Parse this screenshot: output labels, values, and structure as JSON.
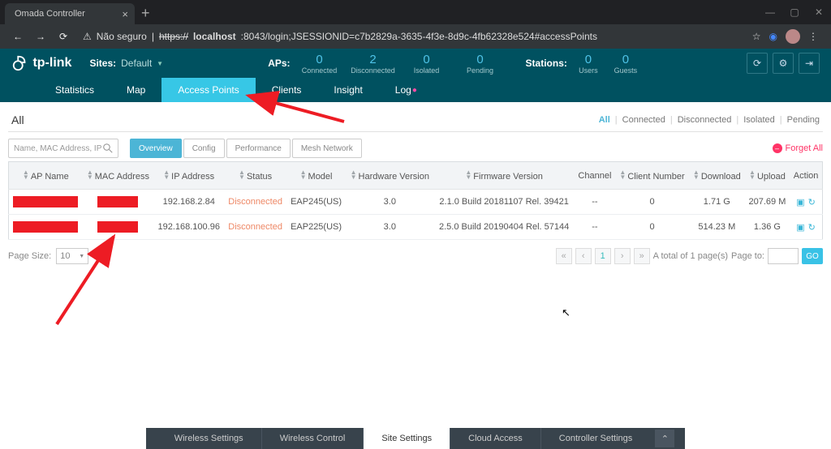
{
  "browser": {
    "tab_title": "Omada Controller",
    "insecure_label": "Não seguro",
    "url_proto": "https://",
    "url_host": "localhost",
    "url_rest": ":8043/login;JSESSIONID=c7b2829a-3635-4f3e-8d9c-4fb62328e524#accessPoints"
  },
  "header": {
    "brand": "tp-link",
    "sites_label": "Sites:",
    "sites_value": "Default",
    "aps_label": "APs:",
    "stations_label": "Stations:",
    "stats_ap": [
      {
        "v": "0",
        "l": "Connected"
      },
      {
        "v": "2",
        "l": "Disconnected"
      },
      {
        "v": "0",
        "l": "Isolated"
      },
      {
        "v": "0",
        "l": "Pending"
      }
    ],
    "stats_st": [
      {
        "v": "0",
        "l": "Users"
      },
      {
        "v": "0",
        "l": "Guests"
      }
    ]
  },
  "nav": {
    "items": [
      "Statistics",
      "Map",
      "Access Points",
      "Clients",
      "Insight",
      "Log"
    ],
    "active": 2
  },
  "page": {
    "title": "All",
    "filters": [
      "All",
      "Connected",
      "Disconnected",
      "Isolated",
      "Pending"
    ],
    "search_placeholder": "Name, MAC Address, IP",
    "view_tabs": [
      "Overview",
      "Config",
      "Performance",
      "Mesh Network"
    ],
    "forget_all": "Forget All"
  },
  "table": {
    "cols": [
      "AP Name",
      "MAC Address",
      "IP Address",
      "Status",
      "Model",
      "Hardware Version",
      "Firmware Version",
      "Channel",
      "Client Number",
      "Download",
      "Upload",
      "Action"
    ],
    "rows": [
      {
        "ip": "192.168.2.84",
        "status": "Disconnected",
        "model": "EAP245(US)",
        "hw": "3.0",
        "fw": "2.1.0 Build 20181107 Rel. 39421",
        "ch": "--",
        "cl": "0",
        "dl": "1.71 G",
        "ul": "207.69 M"
      },
      {
        "ip": "192.168.100.96",
        "status": "Disconnected",
        "model": "EAP225(US)",
        "hw": "3.0",
        "fw": "2.5.0 Build 20190404 Rel. 57144",
        "ch": "--",
        "cl": "0",
        "dl": "514.23 M",
        "ul": "1.36 G"
      }
    ]
  },
  "pager": {
    "page_size_label": "Page Size:",
    "page_size": "10",
    "total": "A total of 1 page(s)",
    "page_to": "Page to:",
    "go": "GO",
    "current": "1"
  },
  "footer": {
    "tabs": [
      "Wireless Settings",
      "Wireless Control",
      "Site Settings",
      "Cloud Access",
      "Controller Settings"
    ],
    "active": 2
  }
}
